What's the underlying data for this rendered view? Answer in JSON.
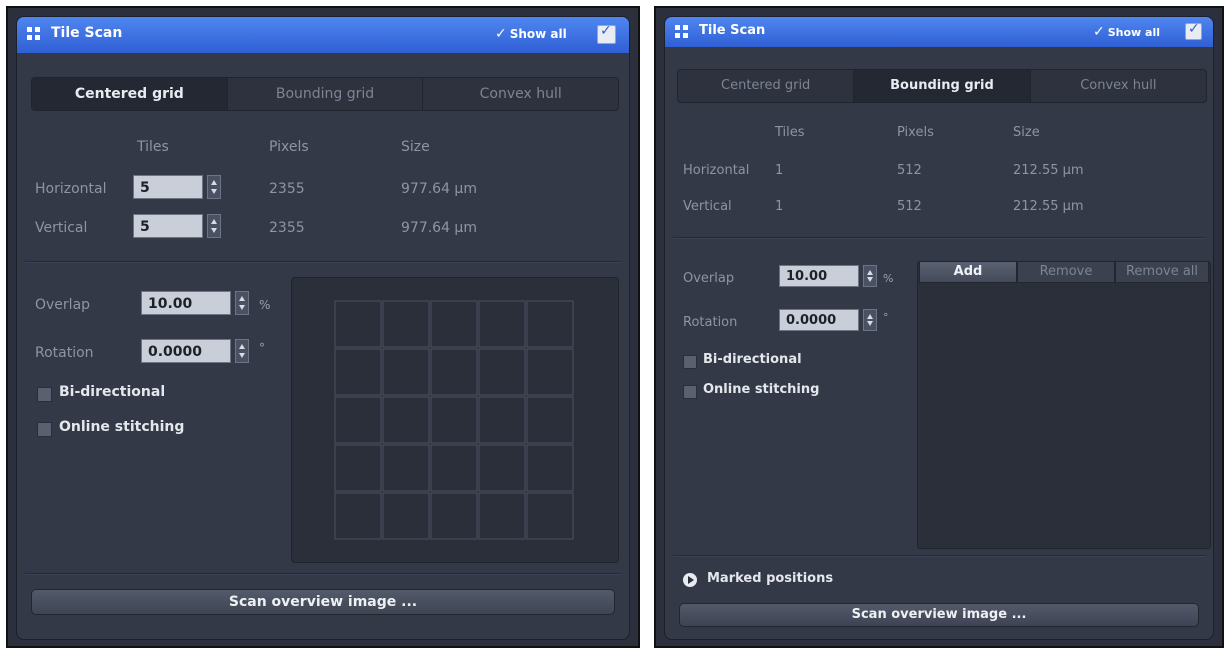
{
  "left_panel": {
    "title": "Tile Scan",
    "show_all": "Show all",
    "tabs": [
      "Centered grid",
      "Bounding grid",
      "Convex hull"
    ],
    "active_tab": 0,
    "headers": {
      "tiles": "Tiles",
      "pixels": "Pixels",
      "size": "Size"
    },
    "rows": [
      {
        "label": "Horizontal",
        "tiles": "5",
        "pixels": "2355",
        "size": "977.64 µm"
      },
      {
        "label": "Vertical",
        "tiles": "5",
        "pixels": "2355",
        "size": "977.64 µm"
      }
    ],
    "overlap_label": "Overlap",
    "overlap_value": "10.00",
    "overlap_unit": "%",
    "rotation_label": "Rotation",
    "rotation_value": "0.0000",
    "rotation_unit": "°",
    "bidirectional": "Bi-directional",
    "online_stitching": "Online stitching",
    "grid_cols": 5,
    "grid_rows": 5,
    "scan_button": "Scan overview image ..."
  },
  "right_panel": {
    "title": "Tile Scan",
    "show_all": "Show all",
    "tabs": [
      "Centered grid",
      "Bounding grid",
      "Convex hull"
    ],
    "active_tab": 1,
    "headers": {
      "tiles": "Tiles",
      "pixels": "Pixels",
      "size": "Size"
    },
    "rows": [
      {
        "label": "Horizontal",
        "tiles": "1",
        "pixels": "512",
        "size": "212.55 µm"
      },
      {
        "label": "Vertical",
        "tiles": "1",
        "pixels": "512",
        "size": "212.55 µm"
      }
    ],
    "overlap_label": "Overlap",
    "overlap_value": "10.00",
    "overlap_unit": "%",
    "rotation_label": "Rotation",
    "rotation_value": "0.0000",
    "rotation_unit": "°",
    "bidirectional": "Bi-directional",
    "online_stitching": "Online stitching",
    "list_buttons": {
      "add": "Add",
      "remove": "Remove",
      "remove_all": "Remove all"
    },
    "marked_positions": "Marked positions",
    "scan_button": "Scan overview image ..."
  },
  "colors": {
    "title_bar": "#3a6fe0",
    "panel_bg": "#333947",
    "accent_text": "#ffffff"
  }
}
